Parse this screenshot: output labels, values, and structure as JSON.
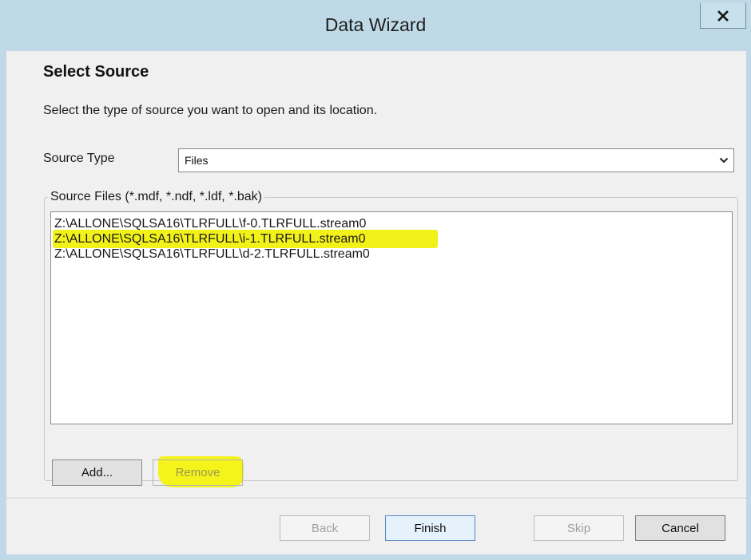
{
  "window": {
    "title": "Data Wizard",
    "close_glyph": "x"
  },
  "page": {
    "title": "Select Source",
    "description": "Select the type of source you want to open and its location."
  },
  "source_type": {
    "label": "Source Type",
    "selected": "Files",
    "icon": "chevron-down-icon"
  },
  "source_files": {
    "legend": "Source Files (*.mdf, *.ndf, *.ldf, *.bak)",
    "items": [
      {
        "path": "Z:\\ALLONE\\SQLSA16\\TLRFULL\\f-0.TLRFULL.stream0",
        "highlighted": false
      },
      {
        "path": "Z:\\ALLONE\\SQLSA16\\TLRFULL\\i-1.TLRFULL.stream0",
        "highlighted": true
      },
      {
        "path": "Z:\\ALLONE\\SQLSA16\\TLRFULL\\d-2.TLRFULL.stream0",
        "highlighted": false
      }
    ]
  },
  "buttons": {
    "add": "Add...",
    "remove": "Remove",
    "back": "Back",
    "finish": "Finish",
    "skip": "Skip",
    "cancel": "Cancel"
  },
  "colors": {
    "titlebar": "#bfd9e7",
    "highlight": "#f2f21a",
    "default_button_border": "#5a8ac6"
  }
}
